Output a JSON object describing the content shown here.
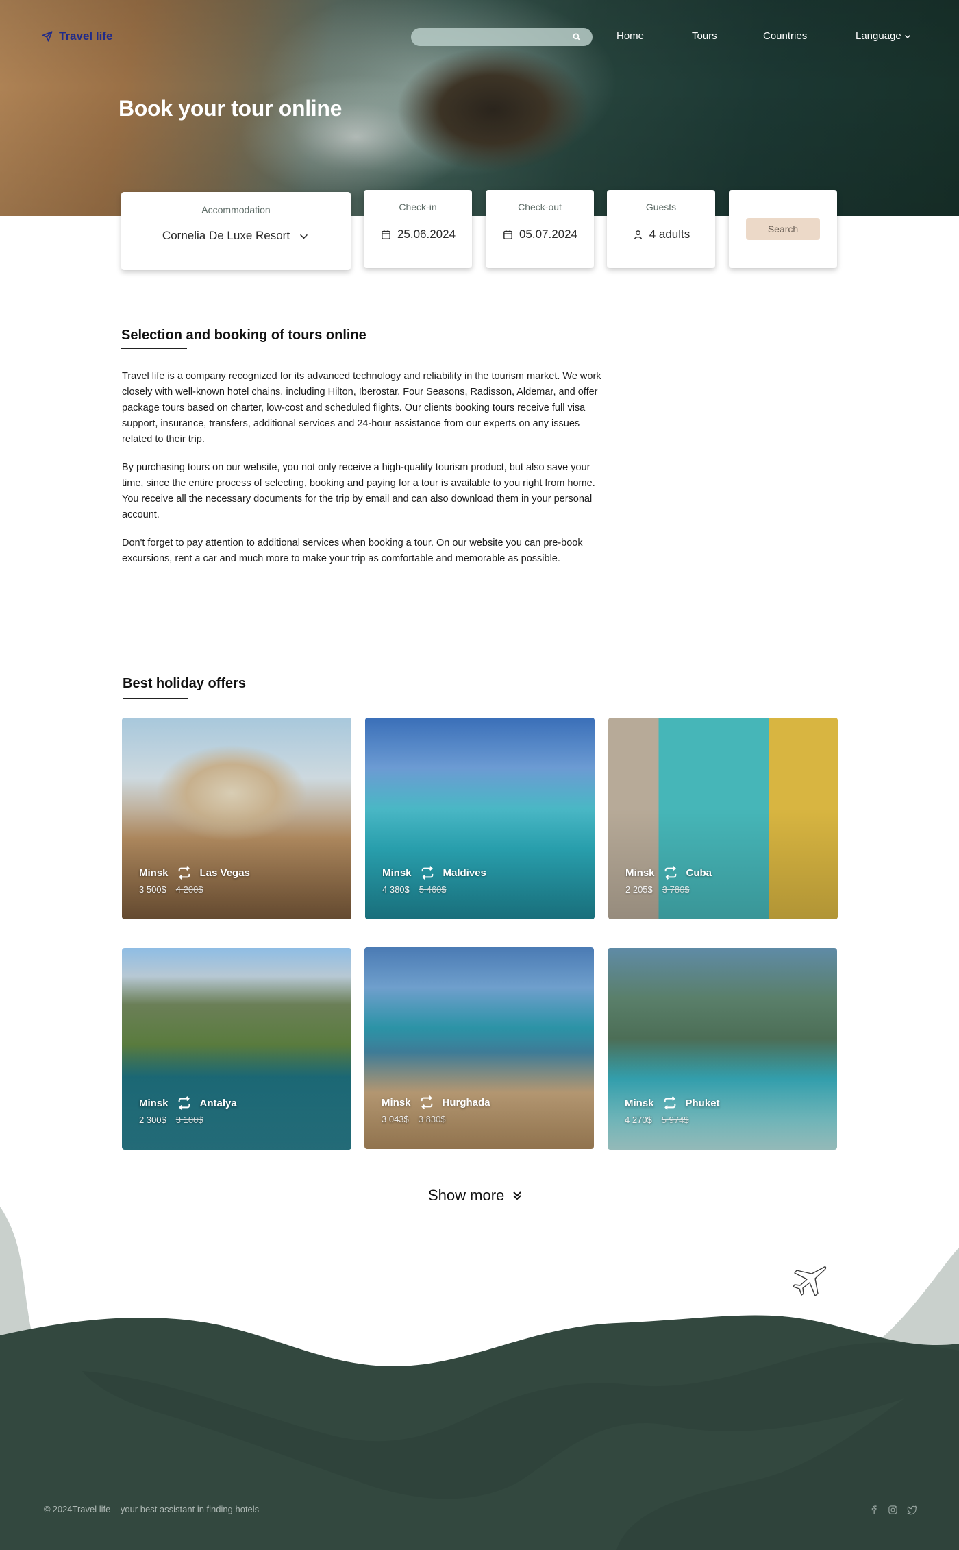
{
  "header": {
    "logo_text": "Travel life",
    "nav": {
      "home": "Home",
      "tours": "Tours",
      "countries": "Countries",
      "language": "Language"
    }
  },
  "hero": {
    "title": "Book your tour online"
  },
  "booking": {
    "accommodation_label": "Accommodation",
    "accommodation_value": "Cornelia De Luxe Resort",
    "checkin_label": "Check-in",
    "checkin_value": "25.06.2024",
    "checkout_label": "Check-out",
    "checkout_value": "05.07.2024",
    "guests_label": "Guests",
    "guests_value": "4 adults",
    "search_label": "Search"
  },
  "about": {
    "title": "Selection and booking of tours online",
    "paragraphs": [
      "Travel life is a company recognized for its advanced technology and reliability in the tourism market.  We work closely with well-known hotel chains, including Hilton, Iberostar, Four Seasons, Radisson, Aldemar, and offer package tours based on charter, low-cost and scheduled flights.  Our clients booking tours receive full visa support, insurance, transfers, additional services and 24-hour assistance from our experts on any issues related to their trip.",
      "By purchasing tours on our website, you not only receive a high-quality tourism product, but also save your time, since the entire process of selecting, booking and paying for a tour is available to you right from home.  You receive all the necessary documents for the trip by email and can also download them in your personal account.",
      "Don't forget to pay attention to additional services when booking a tour.  On our website you can pre-book excursions, rent a car and much more to make your trip as comfortable and memorable as possible."
    ]
  },
  "offers": {
    "title": "Best holiday offers",
    "items": [
      {
        "from": "Minsk",
        "to": "Las Vegas",
        "price": "3 500$",
        "old_price": "4 200$"
      },
      {
        "from": "Minsk",
        "to": "Maldives",
        "price": "4 380$",
        "old_price": "5 460$"
      },
      {
        "from": "Minsk",
        "to": "Cuba",
        "price": "2 205$",
        "old_price": "3 780$"
      },
      {
        "from": "Minsk",
        "to": "Antalya",
        "price": "2 300$",
        "old_price": "3 100$"
      },
      {
        "from": "Minsk",
        "to": "Hurghada",
        "price": "3 043$",
        "old_price": "3 830$"
      },
      {
        "from": "Minsk",
        "to": "Phuket",
        "price": "4 270$",
        "old_price": "5 974$"
      }
    ],
    "show_more": "Show more"
  },
  "footer": {
    "copyright_symbol": "©",
    "copyright_text": "2024Travel life – your best assistant in finding hotels"
  },
  "colors": {
    "brand_blue": "#1f2a8a",
    "footer_dark": "#33483f",
    "footer_light": "#c9d0cc",
    "search_button": "#ecd9c8"
  }
}
